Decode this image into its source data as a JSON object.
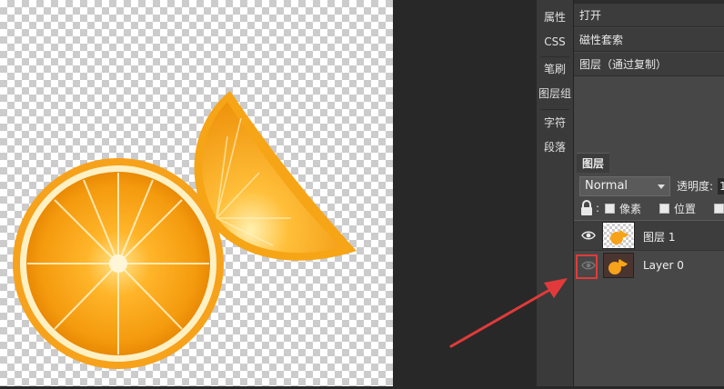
{
  "side_tabs": [
    {
      "label": "属性"
    },
    {
      "label": "CSS"
    },
    {
      "label": "笔刷"
    },
    {
      "label": "图层组"
    },
    {
      "label": "字符"
    },
    {
      "label": "段落"
    }
  ],
  "history": {
    "items": [
      {
        "label": "打开"
      },
      {
        "label": "磁性套索"
      },
      {
        "label": "图层（通过复制）"
      }
    ]
  },
  "layers_panel": {
    "tab_label": "图层",
    "blend_mode": "Normal",
    "opacity_label": "透明度:",
    "opacity_value": "1",
    "lock_colon": ":",
    "lock_options": [
      {
        "label": "像素"
      },
      {
        "label": "位置"
      }
    ],
    "layers": [
      {
        "name": "图层 1",
        "visible": true
      },
      {
        "name": "Layer 0",
        "visible": false
      }
    ]
  },
  "colors": {
    "canvas_bg": "#ffffff",
    "panel_bg": "#474747",
    "annotation_red": "#e23a3a",
    "orange": "#f7a21b"
  }
}
